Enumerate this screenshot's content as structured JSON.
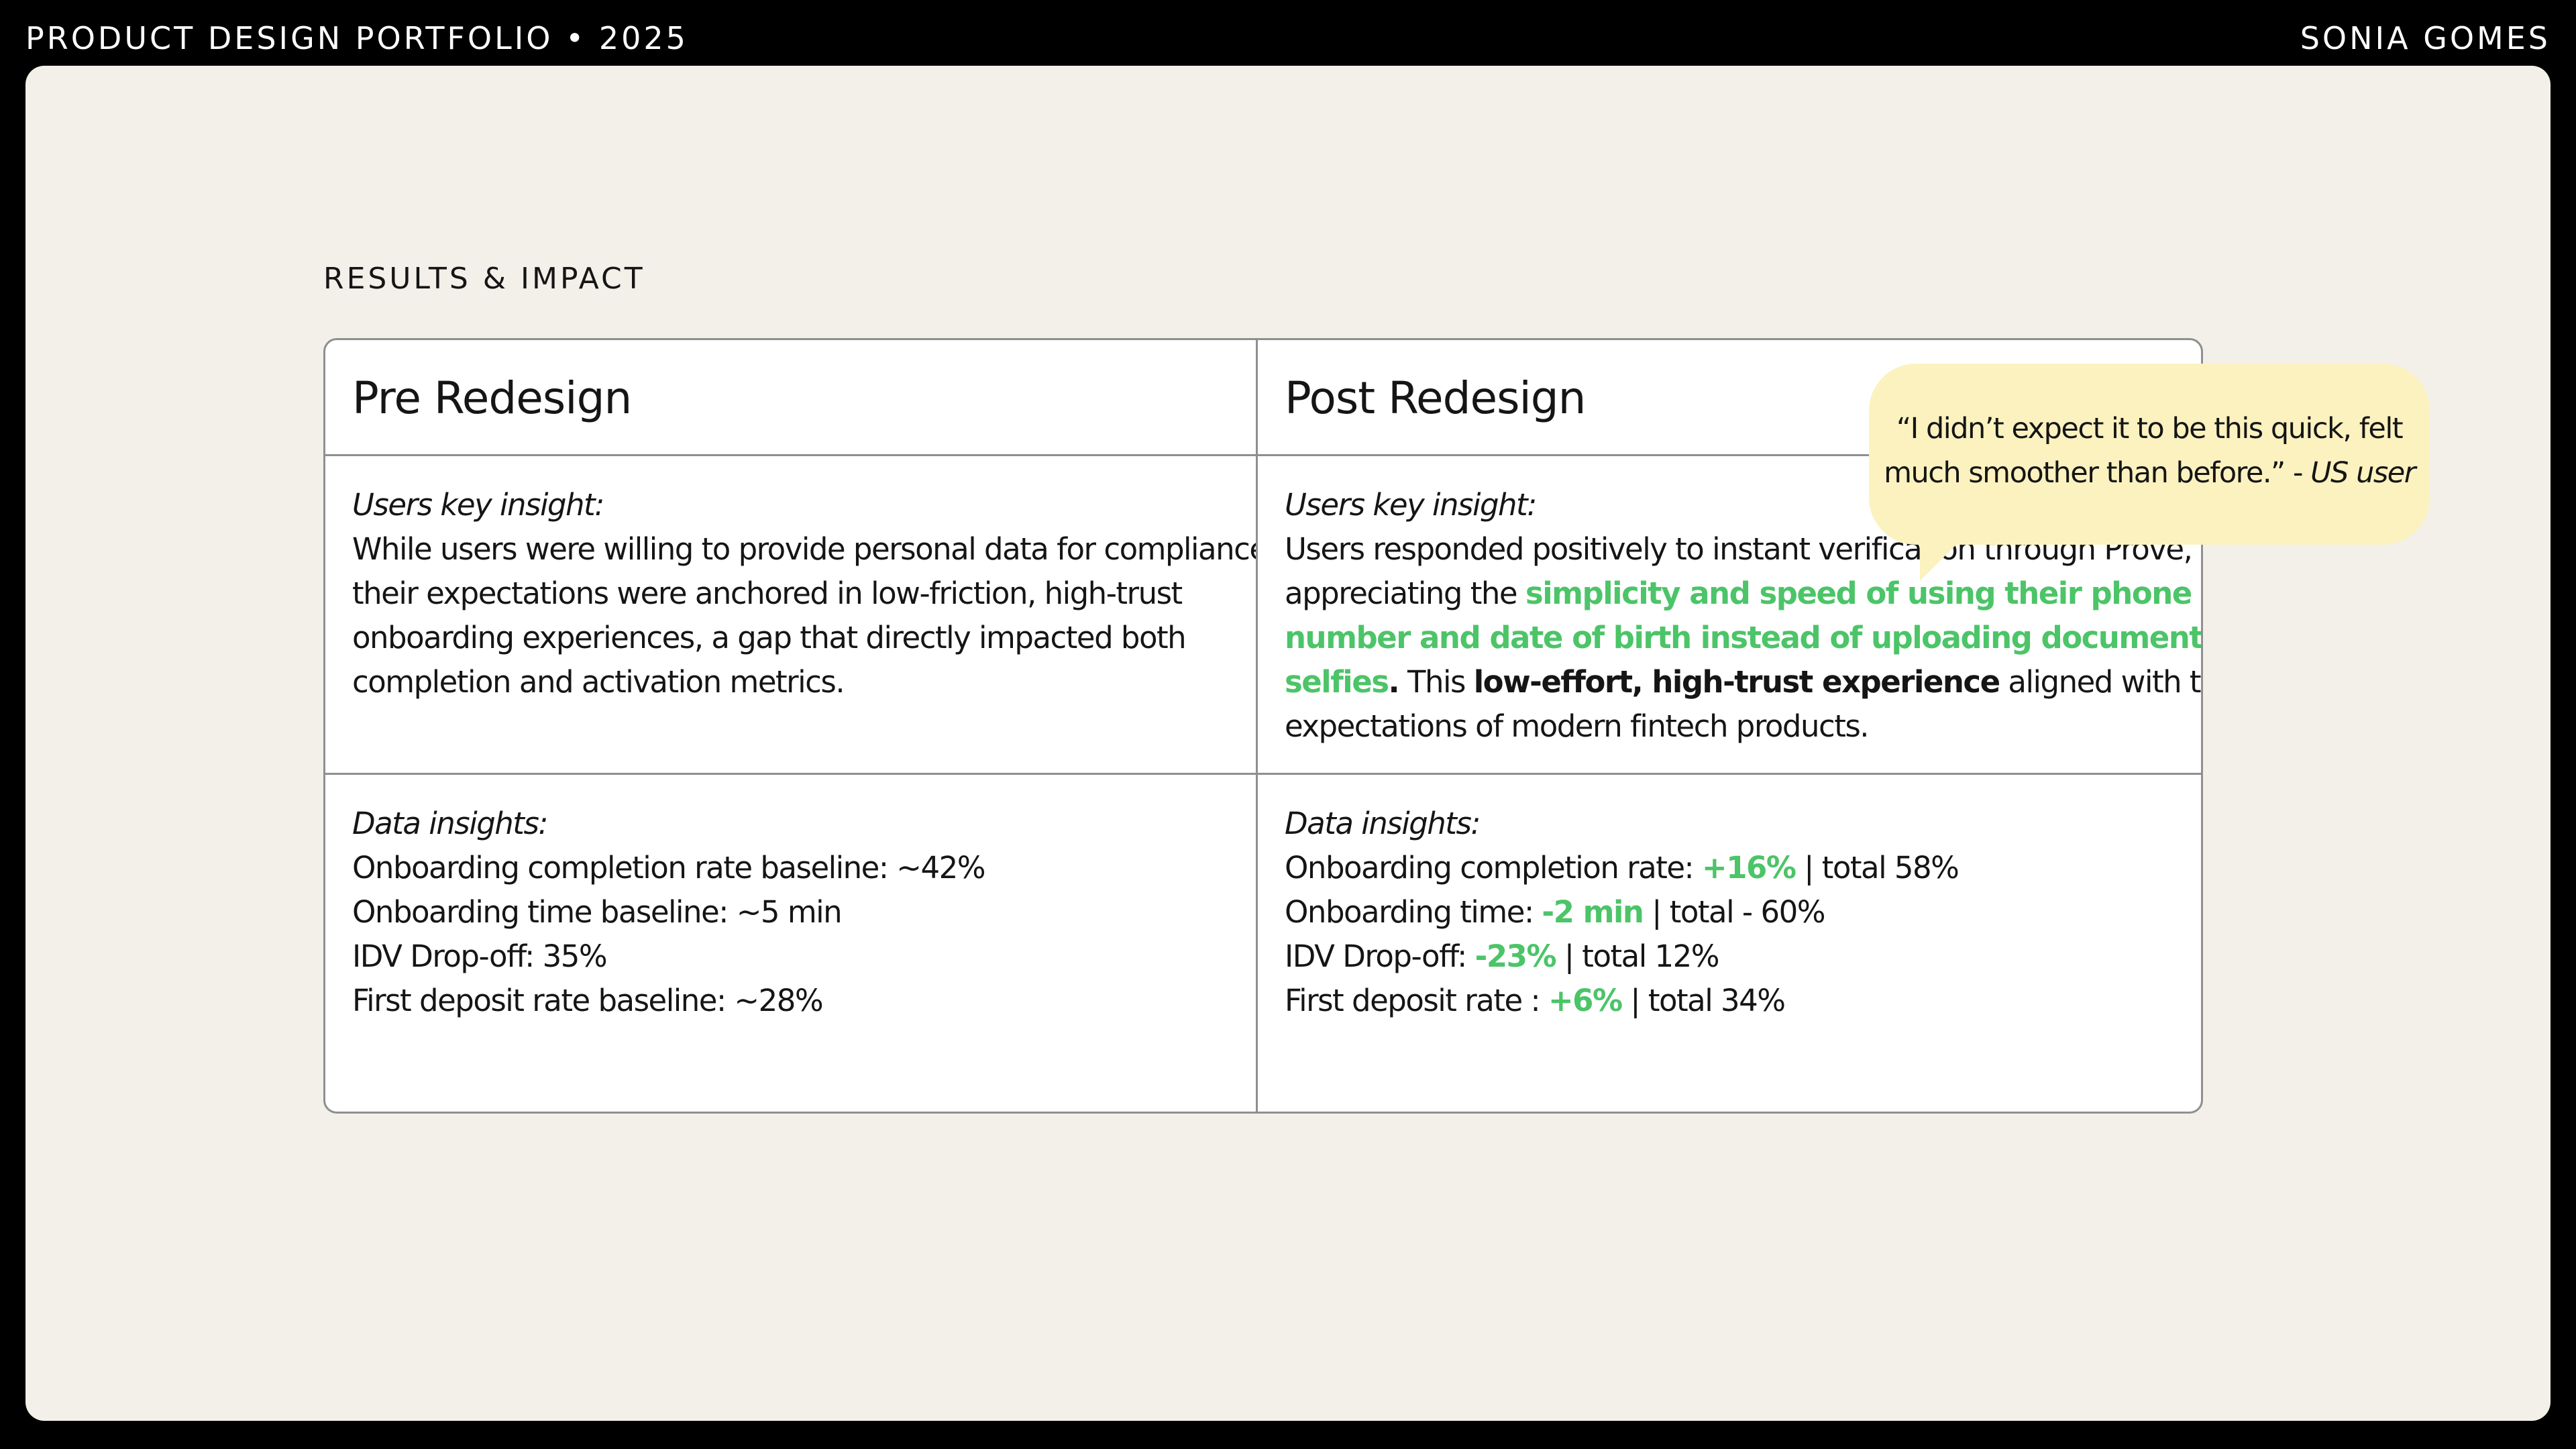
{
  "header": {
    "portfolio_label": "PRODUCT DESIGN PORTFOLIO • 2025",
    "author": "SONIA GOMES"
  },
  "section": {
    "title": "RESULTS & IMPACT"
  },
  "table": {
    "pre": {
      "heading": "Pre Redesign",
      "insight_label": "Users key insight:",
      "insight_lines": [
        "While users were willing to provide personal data for compliance,",
        "their expectations were anchored in low-friction, high-trust",
        "onboarding experiences, a gap that directly impacted both",
        "completion and activation metrics."
      ],
      "data_label": "Data insights:",
      "data_lines": [
        "Onboarding completion rate baseline: ~42%",
        "Onboarding time baseline: ~5 min",
        "IDV Drop-off: 35%",
        "First deposit rate baseline: ~28%"
      ]
    },
    "post": {
      "heading": "Post Redesign",
      "insight_label": "Users key insight:",
      "insight_line1": "Users responded positively to instant verification through Prove,",
      "insight_line2_pre": "appreciating the ",
      "insight_line2_green": "simplicity and speed of using their phone",
      "insight_line3_green": "number and date of birth instead of uploading documents or",
      "insight_line4_green": "selfies",
      "insight_line4_period": ".",
      "insight_line4_mid": " This ",
      "insight_line4_bold": "low-effort, high-trust experience",
      "insight_line4_post": " aligned with their",
      "insight_line5": "expectations of modern fintech products.",
      "data_label": "Data insights:",
      "metrics": [
        {
          "label": "Onboarding completion rate: ",
          "delta": "+16%",
          "total": " | total 58%"
        },
        {
          "label": "Onboarding time: ",
          "delta": "-2 min",
          "total": " | total - 60%"
        },
        {
          "label": "IDV Drop-off: ",
          "delta": "-23%",
          "total": " | total 12%"
        },
        {
          "label": "First deposit rate : ",
          "delta": "+6%",
          "total": " | total 34%"
        }
      ]
    }
  },
  "quote": {
    "line1": "“I didn’t expect it to be this quick, felt",
    "line2": "much smoother than before.” - ",
    "attribution": "US user"
  },
  "colors": {
    "accent_green": "#4cc468",
    "bubble": "#fbf2bf",
    "canvas": "#f3f0ea"
  }
}
